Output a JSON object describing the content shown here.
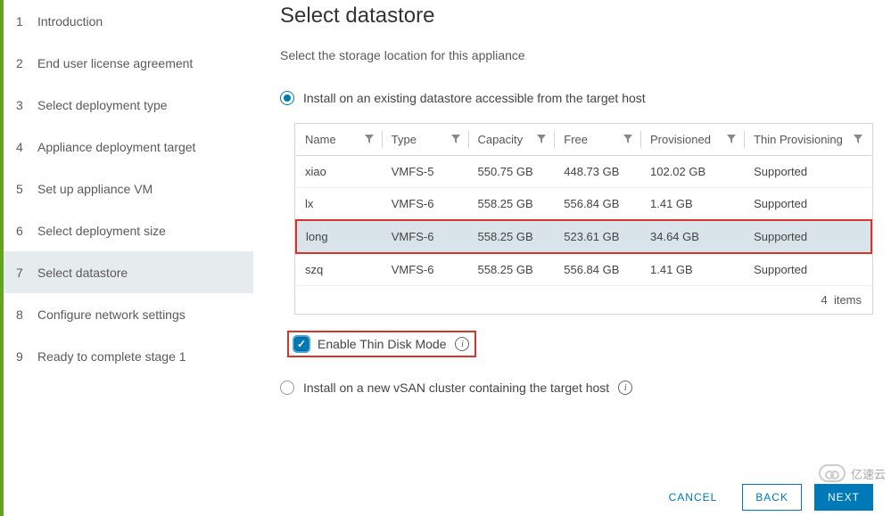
{
  "sidebar": {
    "items": [
      {
        "num": "1",
        "label": "Introduction"
      },
      {
        "num": "2",
        "label": "End user license agreement"
      },
      {
        "num": "3",
        "label": "Select deployment type"
      },
      {
        "num": "4",
        "label": "Appliance deployment target"
      },
      {
        "num": "5",
        "label": "Set up appliance VM"
      },
      {
        "num": "6",
        "label": "Select deployment size"
      },
      {
        "num": "7",
        "label": "Select datastore"
      },
      {
        "num": "8",
        "label": "Configure network settings"
      },
      {
        "num": "9",
        "label": "Ready to complete stage 1"
      }
    ],
    "active_index": 6
  },
  "main": {
    "title": "Select datastore",
    "subtitle": "Select the storage location for this appliance",
    "option_existing": "Install on an existing datastore accessible from the target host",
    "option_vsan": "Install on a new vSAN cluster containing the target host",
    "thin_mode_label": "Enable Thin Disk Mode",
    "table": {
      "columns": [
        "Name",
        "Type",
        "Capacity",
        "Free",
        "Provisioned",
        "Thin Provisioning"
      ],
      "rows": [
        {
          "name": "xiao",
          "type": "VMFS-5",
          "capacity": "550.75 GB",
          "free": "448.73 GB",
          "provisioned": "102.02 GB",
          "thin": "Supported"
        },
        {
          "name": "lx",
          "type": "VMFS-6",
          "capacity": "558.25 GB",
          "free": "556.84 GB",
          "provisioned": "1.41 GB",
          "thin": "Supported"
        },
        {
          "name": "long",
          "type": "VMFS-6",
          "capacity": "558.25 GB",
          "free": "523.61 GB",
          "provisioned": "34.64 GB",
          "thin": "Supported"
        },
        {
          "name": "szq",
          "type": "VMFS-6",
          "capacity": "558.25 GB",
          "free": "556.84 GB",
          "provisioned": "1.41 GB",
          "thin": "Supported"
        }
      ],
      "selected_index": 2,
      "footer_count": "4",
      "footer_label": "items"
    }
  },
  "footer": {
    "cancel": "CANCEL",
    "back": "BACK",
    "next": "NEXT"
  },
  "watermark": "亿速云"
}
